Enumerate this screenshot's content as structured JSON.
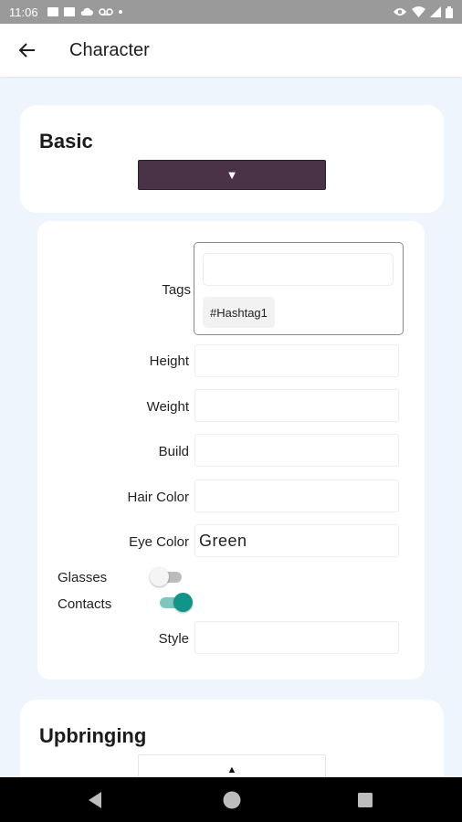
{
  "status_bar": {
    "time": "11:06"
  },
  "app_bar": {
    "title": "Character"
  },
  "basic_section": {
    "title": "Basic",
    "dropdown_arrow": "▼"
  },
  "fields": {
    "tags_label": "Tags",
    "tag_chip": "#Hashtag1",
    "height_label": "Height",
    "height_value": "",
    "weight_label": "Weight",
    "weight_value": "",
    "build_label": "Build",
    "build_value": "",
    "hair_color_label": "Hair Color",
    "hair_color_value": "",
    "eye_color_label": "Eye Color",
    "eye_color_value": "Green",
    "glasses_label": "Glasses",
    "glasses_on": false,
    "contacts_label": "Contacts",
    "contacts_on": true,
    "style_label": "Style",
    "style_value": ""
  },
  "upbringing_section": {
    "title": "Upbringing",
    "dropdown_arrow": "▲"
  },
  "colors": {
    "accent": "#0f9688",
    "dropdown_bg": "#4a3347",
    "page_bg": "#eef5fc"
  },
  "icons": {
    "back": "arrow-left-icon",
    "nav_back": "triangle-back-icon",
    "nav_home": "circle-home-icon",
    "nav_recents": "square-recents-icon"
  }
}
